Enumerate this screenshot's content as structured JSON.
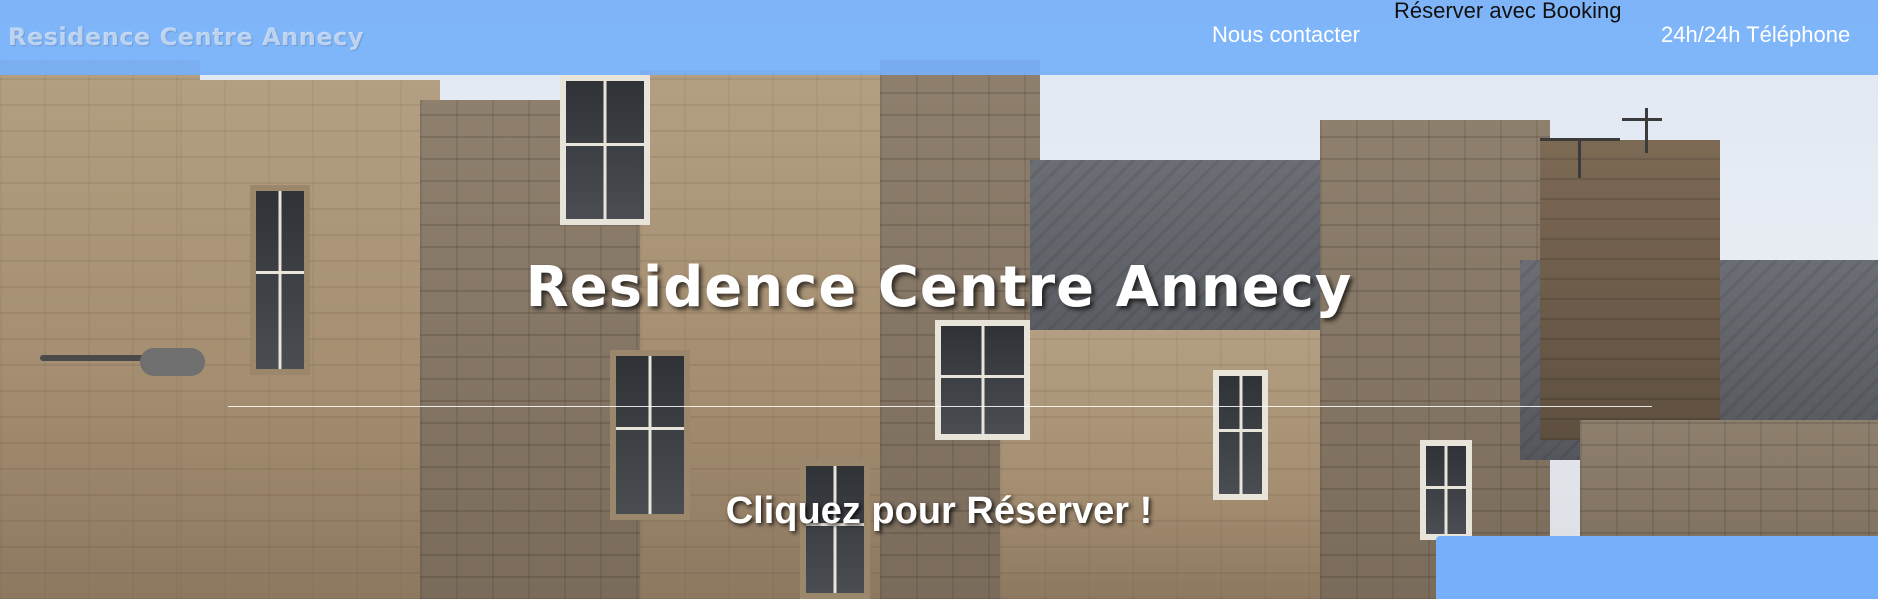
{
  "site": {
    "brand": "Residence Centre Annecy"
  },
  "nav": {
    "contact": "Nous contacter",
    "booking": "Réserver avec Booking",
    "phone": "24h/24h Téléphone"
  },
  "hero": {
    "title": "Residence Centre Annecy",
    "cta": "Cliquez pour Réserver !",
    "image": "edinburgh-style-stone-tenement-rooftops"
  },
  "colors": {
    "topbar": "#76b0fa",
    "text_light": "#ffffff",
    "text_dark": "#111111"
  }
}
